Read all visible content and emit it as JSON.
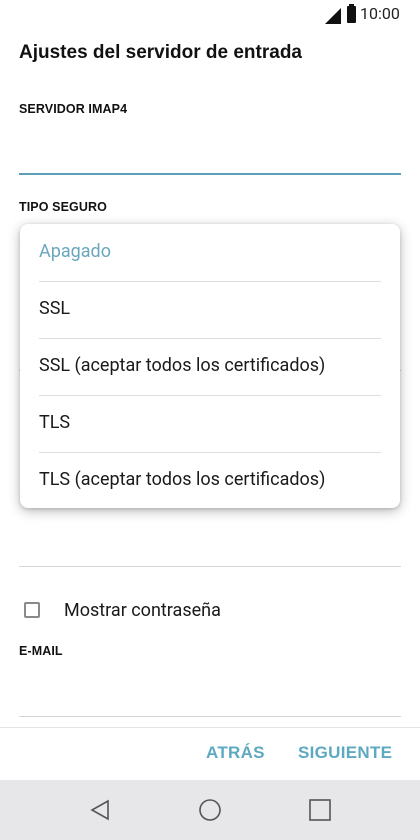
{
  "status_bar": {
    "time": "10:00",
    "signal_icon": "signal-icon",
    "battery_icon": "battery-icon"
  },
  "header": {
    "title": "Ajustes del servidor de entrada"
  },
  "form": {
    "imap_label": "SERVIDOR IMAP4",
    "imap_value": "",
    "security_label": "TIPO SEGURO",
    "security_value": "Apagado",
    "show_password_label": "Mostrar contraseña",
    "email_label": "E-MAIL",
    "email_value": ""
  },
  "dropdown": {
    "options": [
      {
        "label": "Apagado",
        "selected": true
      },
      {
        "label": "SSL",
        "selected": false
      },
      {
        "label": "SSL (aceptar todos los certificados)",
        "selected": false
      },
      {
        "label": "TLS",
        "selected": false
      },
      {
        "label": "TLS (aceptar todos los certificados)",
        "selected": false
      }
    ]
  },
  "actions": {
    "back_label": "ATRÁS",
    "next_label": "SIGUIENTE"
  },
  "navbar": {
    "back_icon": "back-triangle-icon",
    "home_icon": "home-circle-icon",
    "recents_icon": "recents-square-icon"
  },
  "colors": {
    "accent": "#5ea9c2",
    "selected_option": "#6aa7bd",
    "navbar_bg": "#e7e7e9"
  }
}
